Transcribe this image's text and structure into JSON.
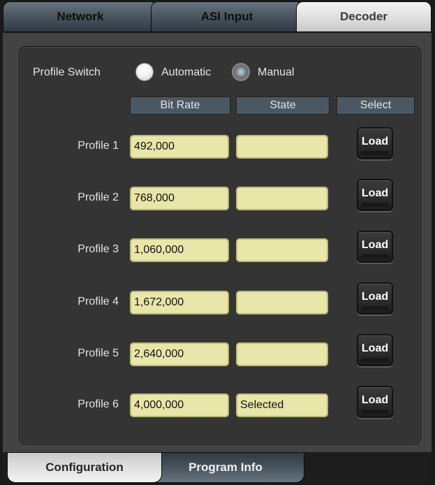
{
  "top_tabs": [
    {
      "label": "Network",
      "active": false
    },
    {
      "label": "ASI Input",
      "active": false
    },
    {
      "label": "Decoder",
      "active": true
    }
  ],
  "profile_switch": {
    "label": "Profile Switch",
    "options": [
      {
        "label": "Automatic",
        "selected": false
      },
      {
        "label": "Manual",
        "selected": true
      }
    ]
  },
  "columns": {
    "bit_rate": "Bit Rate",
    "state": "State",
    "select": "Select"
  },
  "profiles": [
    {
      "label": "Profile 1",
      "bit_rate": "492,000",
      "state": "",
      "button": "Load"
    },
    {
      "label": "Profile 2",
      "bit_rate": "768,000",
      "state": "",
      "button": "Load"
    },
    {
      "label": "Profile 3",
      "bit_rate": "1,060,000",
      "state": "",
      "button": "Load"
    },
    {
      "label": "Profile 4",
      "bit_rate": "1,672,000",
      "state": "",
      "button": "Load"
    },
    {
      "label": "Profile 5",
      "bit_rate": "2,640,000",
      "state": "",
      "button": "Load"
    },
    {
      "label": "Profile 6",
      "bit_rate": "4,000,000",
      "state": "Selected",
      "button": "Load"
    }
  ],
  "bottom_tabs": [
    {
      "label": "Configuration",
      "active": true
    },
    {
      "label": "Program Info",
      "active": false
    }
  ],
  "colors": {
    "field_bg": "#e9e6aa",
    "header_bg": "#4a5863",
    "panel_bg": "#343434"
  }
}
